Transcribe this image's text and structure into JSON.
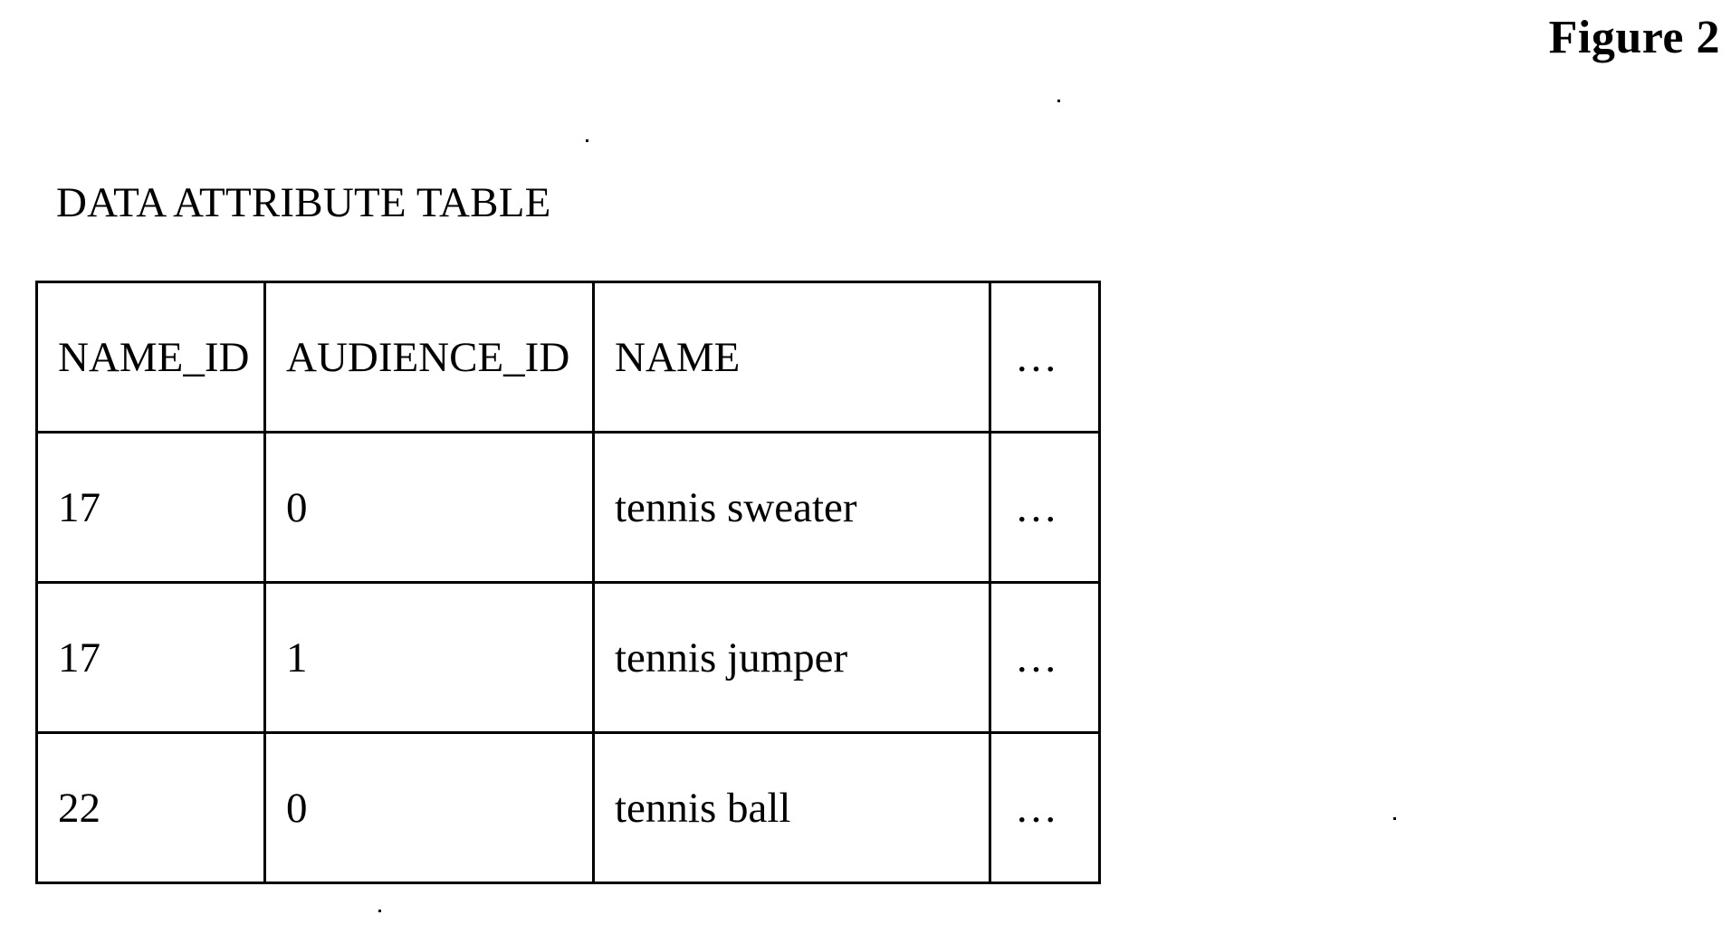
{
  "figure": {
    "label": "Figure 2"
  },
  "table": {
    "title": "DATA ATTRIBUTE TABLE",
    "columns": [
      "NAME_ID",
      "AUDIENCE_ID",
      "NAME",
      "…"
    ],
    "rows": [
      [
        "17",
        "0",
        "tennis sweater",
        "…"
      ],
      [
        "17",
        "1",
        "tennis jumper",
        "…"
      ],
      [
        "22",
        "0",
        "tennis ball",
        "…"
      ]
    ]
  }
}
